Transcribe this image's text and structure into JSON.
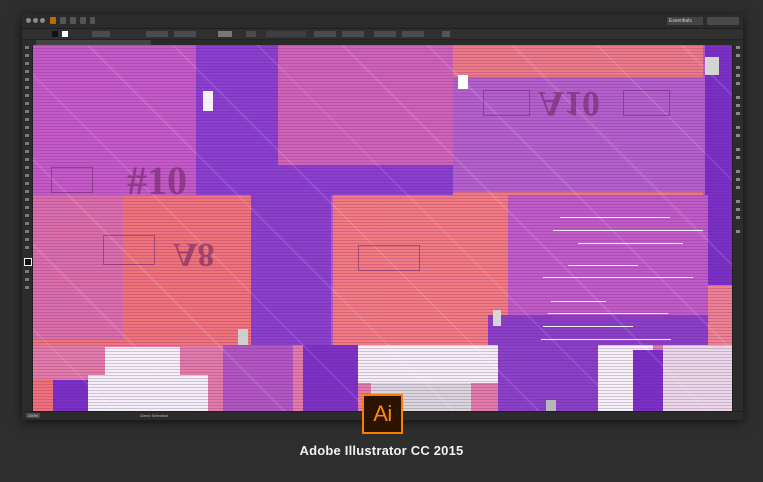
{
  "app": {
    "name": "Adobe Illustrator CC 2015",
    "logo_text": "Ai",
    "brand_color": "#ff7c00"
  },
  "window": {
    "workspace_label": "Essentials",
    "zoom_level": "100%",
    "status_text": "Direct Selection"
  },
  "canvas": {
    "colors": {
      "violet": "#7a2fc7",
      "magenta": "#c45ac7",
      "coral": "#f06f7a",
      "pink": "#e58fb8",
      "white": "#f4f0f6"
    }
  },
  "artwork_text": {
    "fragment_1": "#10",
    "fragment_2": "A10",
    "fragment_3": "A8"
  }
}
